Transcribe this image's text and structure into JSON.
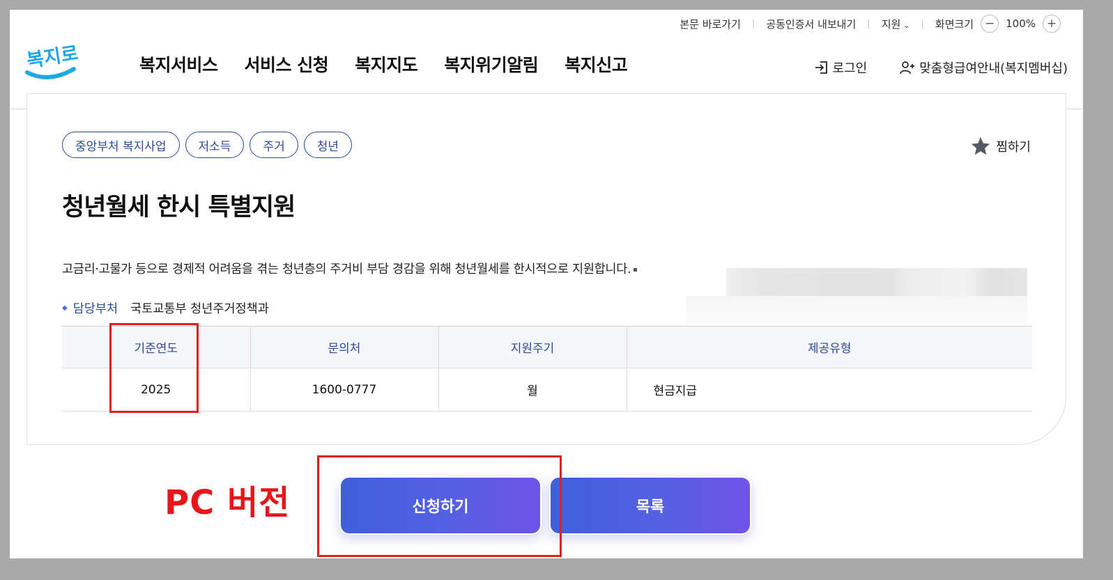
{
  "util_bar": {
    "skip_to_content": "본문 바로가기",
    "cert_export": "공동인증서 내보내기",
    "support": "지원",
    "screen_size": "화면크기",
    "zoom_level": "100%",
    "zoom_out": "−",
    "zoom_in": "+"
  },
  "logo": {
    "text": "복지로"
  },
  "nav": {
    "items": [
      {
        "label": "복지서비스"
      },
      {
        "label": "서비스 신청"
      },
      {
        "label": "복지지도"
      },
      {
        "label": "복지위기알림"
      },
      {
        "label": "복지신고"
      }
    ]
  },
  "account": {
    "login": "로그인",
    "membership": "맞춤형급여안내(복지멤버십)"
  },
  "service": {
    "tags": [
      "중앙부처 복지사업",
      "저소득",
      "주거",
      "청년"
    ],
    "favorite": "찜하기",
    "title": "청년월세 한시 특별지원",
    "description": "고금리·고물가 등으로 경제적 어려움을 겪는 청년층의 주거비 부담 경감을 위해 청년월세를 한시적으로 지원합니다.",
    "dept_label": "담당부처",
    "dept_value": "국토교통부 청년주거정책과"
  },
  "table": {
    "headers": [
      "기준연도",
      "문의처",
      "지원주기",
      "제공유형"
    ],
    "row": [
      "2025",
      "1600-0777",
      "월",
      "현금지급"
    ]
  },
  "annotation": {
    "label": "PC 버전"
  },
  "buttons": {
    "apply": "신청하기",
    "list": "목록"
  },
  "colors": {
    "accent": "#2c4a9b",
    "button_start": "#3f5fdb",
    "button_end": "#7054e8",
    "highlight": "#e0201b",
    "logo_blue": "#1fa8e6"
  }
}
